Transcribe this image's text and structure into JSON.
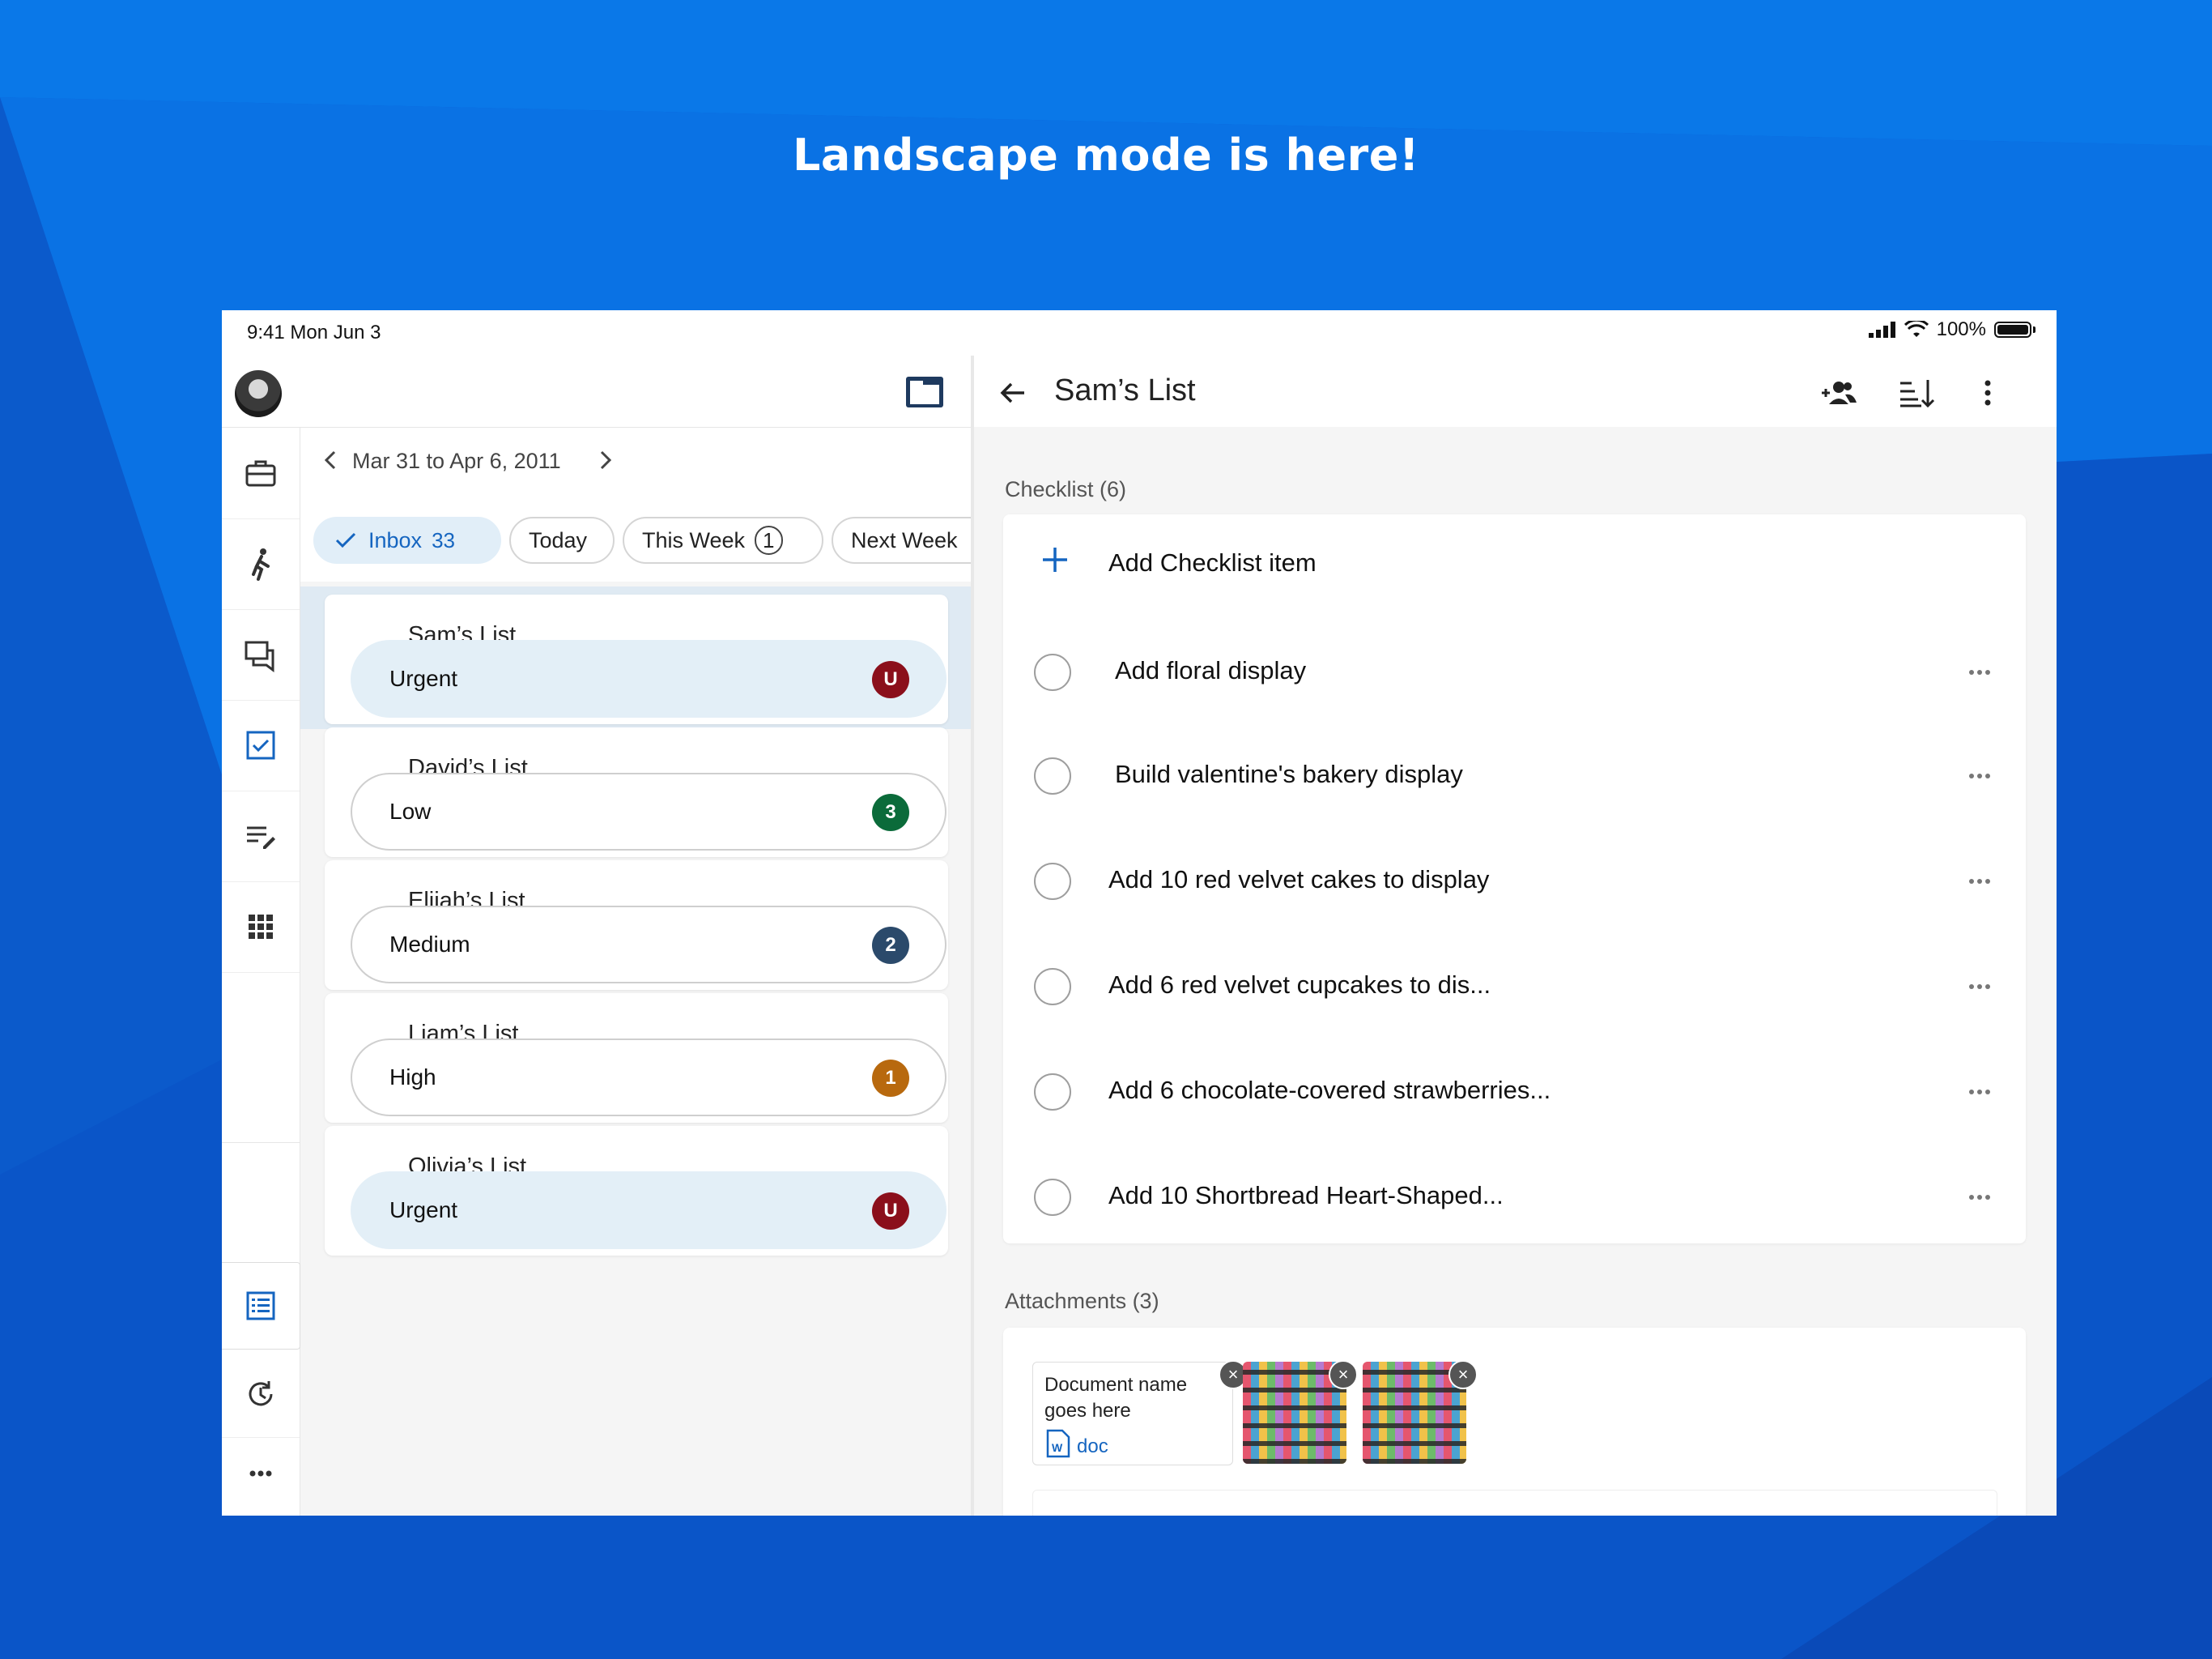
{
  "headline": "Landscape mode is here!",
  "status_bar": {
    "time": "9:41  Mon Jun 3",
    "battery": "100%"
  },
  "left_pane": {
    "date_range": "Mar 31 to Apr 6, 2011",
    "filters": [
      {
        "label": "Inbox",
        "count": "33",
        "active": true
      },
      {
        "label": "Today",
        "count": ""
      },
      {
        "label": "This Week",
        "count": "1"
      },
      {
        "label": "Next Week",
        "count": ""
      }
    ],
    "lists": [
      {
        "title": "Sam’s List",
        "priority": "Urgent",
        "badge": "U",
        "badge_color": "#8b0f1b",
        "selected": true
      },
      {
        "title": "David’s List",
        "priority": "Low",
        "badge": "3",
        "badge_color": "#0b6b3a"
      },
      {
        "title": "Elijah’s List",
        "priority": "Medium",
        "badge": "2",
        "badge_color": "#2b4a6b"
      },
      {
        "title": "Liam’s List",
        "priority": "High",
        "badge": "1",
        "badge_color": "#b8690e"
      },
      {
        "title": "Olivia’s List",
        "priority": "Urgent",
        "badge": "U",
        "badge_color": "#8b0f1b"
      }
    ]
  },
  "right_pane": {
    "title": "Sam’s List",
    "checklist_label": "Checklist (6)",
    "add_item_label": "Add Checklist item",
    "items": [
      "Add floral display",
      "Build valentine's bakery display",
      "Add 10 red velvet cakes to display",
      "Add 6 red velvet cupcakes to dis...",
      "Add 6 chocolate-covered strawberries...",
      "Add 10 Shortbread Heart-Shaped..."
    ],
    "attachments_label": "Attachments (3)",
    "document": {
      "name": "Document name goes here",
      "type": "doc"
    }
  },
  "colors": {
    "accent": "#1565c0",
    "background": "#0b57d0"
  }
}
